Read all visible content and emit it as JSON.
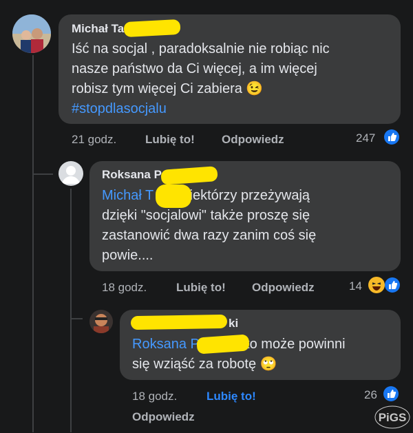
{
  "comments": [
    {
      "author": "Michał Ta",
      "text": "Iść na socjal , paradoksalnie nie robiąc nic nasze  państwo da Ci więcej,  a im więcej robisz tym więcej Ci zabiera 😉",
      "line1": "Iść na socjal , paradoksalnie nie robiąc nic",
      "line2": "nasze  państwo da Ci więcej,  a im więcej",
      "line3": "robisz tym więcej Ci zabiera 😉",
      "hashtag": "#stopdlasocjalu",
      "time": "21 godz.",
      "like_label": "Lubię to!",
      "reply_label": "Odpowiedz",
      "reaction_count": "247"
    },
    {
      "author": "Roksana P",
      "mention": "Michał T",
      "line1_rest": "niektórzy przeżywają",
      "line2": "dzięki \"socjalowi\" także proszę się",
      "line3": "zastanowić dwa razy zanim coś się",
      "line4": "powie....",
      "time": "18 godz.",
      "like_label": "Lubię to!",
      "reply_label": "Odpowiedz",
      "reaction_count": "14"
    },
    {
      "author": "ki",
      "mention": "Roksana P",
      "line1_rest": "to może powinni",
      "line2": "się wziąść za robotę 🙄",
      "time": "18 godz.",
      "like_label": "Lubię to!",
      "reply_label": "Odpowiedz",
      "reaction_count": "26"
    }
  ],
  "watermark": "PiGS",
  "colors": {
    "background": "#18191a",
    "bubble": "#3a3b3c",
    "link": "#4599ff",
    "like_active": "#2d88ff",
    "redaction": "#ffe400"
  },
  "icons": [
    "like-reaction-icon",
    "haha-reaction-icon",
    "default-avatar-icon"
  ]
}
